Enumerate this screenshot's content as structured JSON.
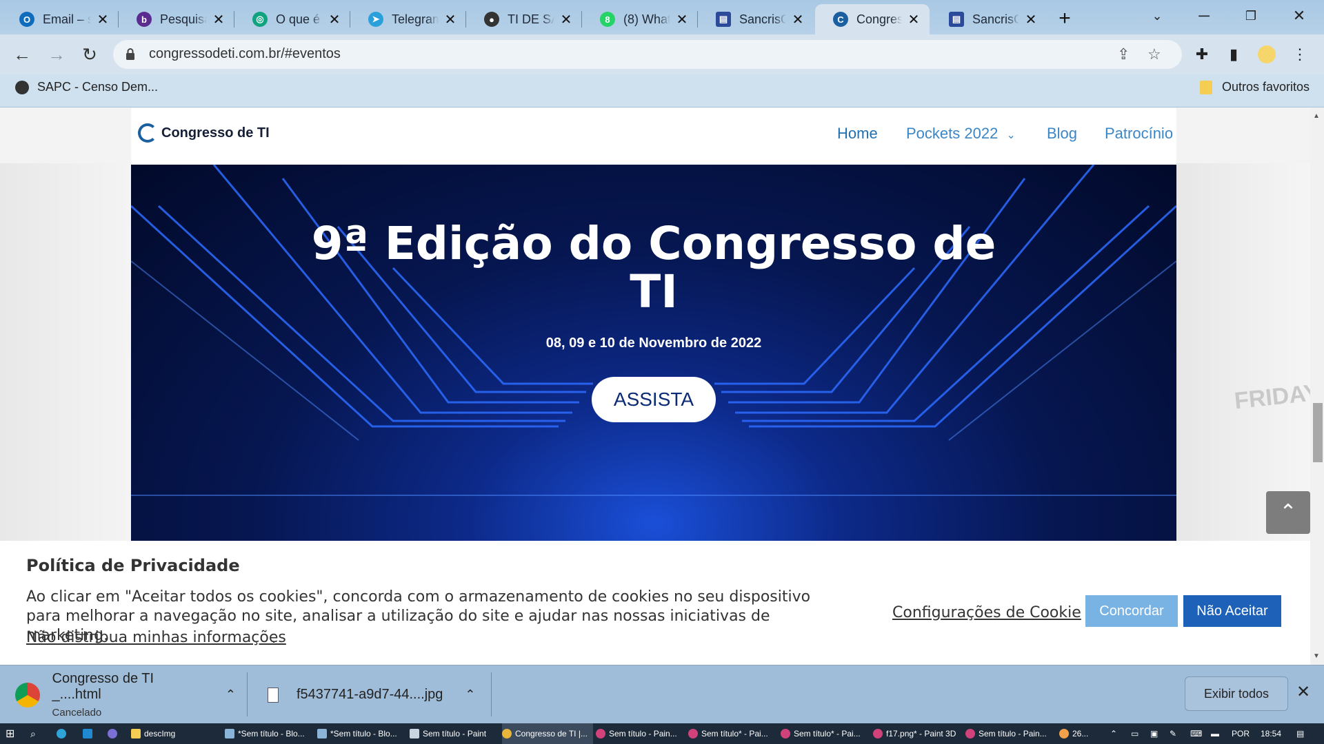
{
  "browser": {
    "tabs": [
      {
        "label": "Email – s",
        "color": "#0f6cbd",
        "glyph": "O"
      },
      {
        "label": "Pesquisa",
        "color": "#5b2c8f",
        "glyph": "b"
      },
      {
        "label": "O que é",
        "color": "#10a37f",
        "glyph": "◎"
      },
      {
        "label": "Telegram",
        "color": "#2aa0da",
        "glyph": "➤"
      },
      {
        "label": "TI DE SA",
        "color": "#333333",
        "glyph": "●"
      },
      {
        "label": "(8) What",
        "color": "#25d366",
        "glyph": "8"
      },
      {
        "label": "SancrisC",
        "color": "#2b4a9a",
        "glyph": "▤"
      },
      {
        "label": "Congres",
        "color": "#1a5fa0",
        "glyph": "C"
      },
      {
        "label": "SancrisC",
        "color": "#2b4a9a",
        "glyph": "▤"
      }
    ],
    "new_tab": "+",
    "url": "congressodeti.com.br/#eventos",
    "bookmarks": {
      "item1": "SAPC - Censo Dem...",
      "others": "Outros favoritos"
    }
  },
  "site": {
    "logo_text": "Congresso de TI",
    "nav": {
      "home": "Home",
      "pockets": "Pockets 2022",
      "blog": "Blog",
      "patrocinio": "Patrocínio"
    },
    "hero": {
      "title_line1": "9ª Edição do Congresso de",
      "title_line2": "TI",
      "date": "08, 09 e 10 de Novembro de 2022",
      "button": "ASSISTA"
    },
    "background_text": "FRIDAY"
  },
  "cookie_banner": {
    "title": "Política de Privacidade",
    "text": "Ao clicar em \"Aceitar todos os cookies\", concorda com o armazenamento de cookies no seu dispositivo para melhorar a navegação no site, analisar a utilização do site e ajudar nas nossas iniciativas de marketing.",
    "do_not_sell": "Não distribua minhas informações",
    "dot": ".",
    "settings": "Configurações de Cookie",
    "accept": "Concordar",
    "reject": "Não Aceitar",
    "accept_color": "#79b3e3",
    "reject_color": "#1e61b8"
  },
  "downloads": {
    "item1": {
      "name": "Congresso de TI _....html",
      "status": "Cancelado"
    },
    "item2": {
      "name": "f5437741-a9d7-44....jpg"
    },
    "show_all": "Exibir todos"
  },
  "taskbar": {
    "items": [
      {
        "label": "descImg",
        "color": "#f5cd52"
      },
      {
        "label": "*Sem título - Blo...",
        "color": "#8ab4d8"
      },
      {
        "label": "*Sem título - Blo...",
        "color": "#8ab4d8"
      },
      {
        "label": "Sem título - Paint",
        "color": "#c9d6e2"
      },
      {
        "label": "Congresso de TI |...",
        "color": "#e8b53a"
      },
      {
        "label": "Sem título - Pain...",
        "color": "#d0437a"
      },
      {
        "label": "Sem título* - Pai...",
        "color": "#d0437a"
      },
      {
        "label": "Sem título* - Pai...",
        "color": "#d0437a"
      },
      {
        "label": "f17.png* - Paint 3D",
        "color": "#d0437a"
      },
      {
        "label": "Sem título - Pain...",
        "color": "#d0437a"
      }
    ],
    "weather": "26...",
    "lang": "POR",
    "time": "18:54"
  }
}
